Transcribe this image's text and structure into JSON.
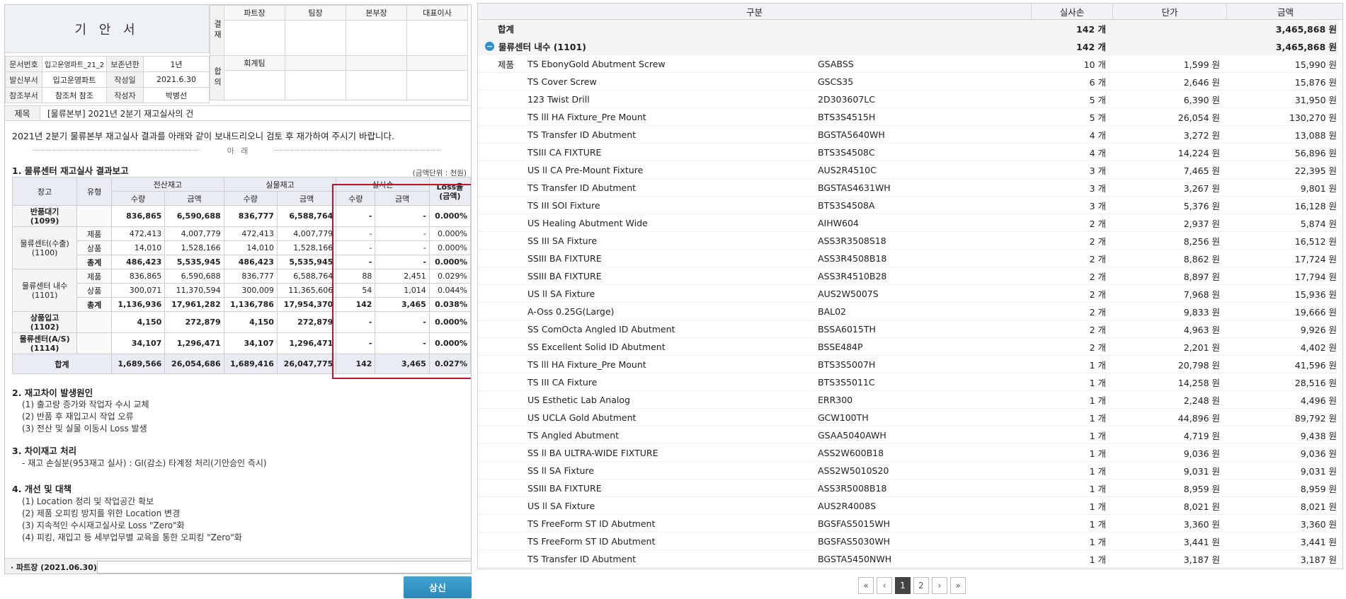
{
  "document": {
    "title": "기 안 서",
    "approval": {
      "side_label_top": "결재",
      "side_label_bottom": "합의",
      "headers": [
        "파트장",
        "팀장",
        "본부장",
        "대표이사"
      ],
      "agree_header": "회계팀"
    },
    "meta": {
      "doc_no_label": "문서번호",
      "doc_no": "입고운영파트_21_2",
      "retention_label": "보존년한",
      "retention": "1년",
      "dept_label": "발신부서",
      "dept": "입고운영파트",
      "date_label": "작성일",
      "date": "2021.6.30",
      "ref_label": "참조부서",
      "ref": "참조처 참조",
      "author_label": "작성자",
      "author": "박병선"
    },
    "subject_label": "제목",
    "subject": "[물류본부] 2021년 2분기 재고실사의 건",
    "intro": "2021년 2분기 물류본부 재고실사 결과를 아래와 같이 보내드리오니 검토 후 재가하여 주시기 바랍니다.",
    "ara": "아 래",
    "sec1": "1. 물류센터 재고실사 결과보고",
    "unit": "(금액단위 : 천원)",
    "table": {
      "h_wh": "창고",
      "h_type": "유형",
      "h_sys": "전산재고",
      "h_phy": "실물재고",
      "h_loss": "실사손",
      "h_rate": "Loss율(금액)",
      "h_qty": "수량",
      "h_amt": "금액",
      "groups": [
        {
          "name": "반품대기\n(1099)",
          "rows": [
            {
              "type": "",
              "v": [
                "836,865",
                "6,590,688",
                "836,777",
                "6,588,764",
                "-",
                "-",
                "0.000%"
              ],
              "bold": true
            }
          ]
        },
        {
          "name": "물류센터(수출)\n(1100)",
          "rows": [
            {
              "type": "제품",
              "v": [
                "472,413",
                "4,007,779",
                "472,413",
                "4,007,779",
                "-",
                "-",
                "0.000%"
              ],
              "bold": false
            },
            {
              "type": "상품",
              "v": [
                "14,010",
                "1,528,166",
                "14,010",
                "1,528,166",
                "-",
                "-",
                "0.000%"
              ],
              "bold": false
            },
            {
              "type": "총계",
              "v": [
                "486,423",
                "5,535,945",
                "486,423",
                "5,535,945",
                "-",
                "-",
                "0.000%"
              ],
              "bold": true
            }
          ]
        },
        {
          "name": "물류센터 내수\n(1101)",
          "rows": [
            {
              "type": "제품",
              "v": [
                "836,865",
                "6,590,688",
                "836,777",
                "6,588,764",
                "88",
                "2,451",
                "0.029%"
              ],
              "bold": false
            },
            {
              "type": "상품",
              "v": [
                "300,071",
                "11,370,594",
                "300,009",
                "11,365,606",
                "54",
                "1,014",
                "0.044%"
              ],
              "bold": false
            },
            {
              "type": "총계",
              "v": [
                "1,136,936",
                "17,961,282",
                "1,136,786",
                "17,954,370",
                "142",
                "3,465",
                "0.038%"
              ],
              "bold": true
            }
          ]
        },
        {
          "name": "상품입고\n(1102)",
          "rows": [
            {
              "type": "",
              "v": [
                "4,150",
                "272,879",
                "4,150",
                "272,879",
                "-",
                "-",
                "0.000%"
              ],
              "bold": true
            }
          ]
        },
        {
          "name": "물류센터(A/S)\n(1114)",
          "rows": [
            {
              "type": "",
              "v": [
                "34,107",
                "1,296,471",
                "34,107",
                "1,296,471",
                "-",
                "-",
                "0.000%"
              ],
              "bold": true
            }
          ]
        }
      ],
      "total_label": "합계",
      "total": [
        "1,689,566",
        "26,054,686",
        "1,689,416",
        "26,047,775",
        "142",
        "3,465",
        "0.027%"
      ]
    },
    "sec2": "2. 재고차이 발생원인",
    "causes": [
      "(1) 출고량 증가와 작업자 수시 교체",
      "(2) 반품 후 재입고시 작업 오류",
      "(3) 전산 및 실물 이동시 Loss 발생"
    ],
    "sec3": "3. 차이재고 처리",
    "handling": "-  재고 손실분(953재고 실사) : GI(감소) 타계정 처리(기안승인 즉시)",
    "sec4": "4. 개선 및 대책",
    "measures": [
      "(1) Location 정리 및 작업공간 확보",
      "(2) 제품 오피킹 방지를 위한 Location 변경",
      "(3) 지속적인 수시재고실사로 Loss \"Zero\"화",
      "(4) 피킹, 재입고 등 세부업무별 교육을 통한 오피킹 \"Zero\"화"
    ],
    "footer_label": "· 파트장  (2021.06.30)",
    "footer_input": "",
    "submit_label": "상신"
  },
  "grid": {
    "headers": [
      "구분",
      "실사손",
      "단가",
      "금액"
    ],
    "total": {
      "label": "합계",
      "qty": "142 개",
      "amount": "3,465,868 원"
    },
    "group": {
      "label": "물류센터 내수 (1101)",
      "qty": "142 개",
      "amount": "3,465,868 원"
    },
    "category": "제품",
    "rows": [
      {
        "name": "TS EbonyGold Abutment Screw",
        "code": "GSABSS",
        "qty": "10 개",
        "price": "1,599 원",
        "amount": "15,990 원"
      },
      {
        "name": "TS Cover Screw",
        "code": "GSCS35",
        "qty": "6 개",
        "price": "2,646 원",
        "amount": "15,876 원"
      },
      {
        "name": "123 Twist Drill",
        "code": "2D303607LC",
        "qty": "5 개",
        "price": "6,390 원",
        "amount": "31,950 원"
      },
      {
        "name": "TS lll HA Fixture_Pre Mount",
        "code": "BTS3S4515H",
        "qty": "5 개",
        "price": "26,054 원",
        "amount": "130,270 원"
      },
      {
        "name": "TS Transfer ID Abutment",
        "code": "BGSTA5640WH",
        "qty": "4 개",
        "price": "3,272 원",
        "amount": "13,088 원"
      },
      {
        "name": "TSIII CA FIXTURE",
        "code": "BTS3S4508C",
        "qty": "4 개",
        "price": "14,224 원",
        "amount": "56,896 원"
      },
      {
        "name": "US ll CA Pre-Mount Fixture",
        "code": "AUS2R4510C",
        "qty": "3 개",
        "price": "7,465 원",
        "amount": "22,395 원"
      },
      {
        "name": "TS Transfer ID Abutment",
        "code": "BGSTAS4631WH",
        "qty": "3 개",
        "price": "3,267 원",
        "amount": "9,801 원"
      },
      {
        "name": "TS III SOI Fixture",
        "code": "BTS3S4508A",
        "qty": "3 개",
        "price": "5,376 원",
        "amount": "16,128 원"
      },
      {
        "name": "US Healing Abutment Wide",
        "code": "AIHW604",
        "qty": "2 개",
        "price": "2,937 원",
        "amount": "5,874 원"
      },
      {
        "name": "SS III SA Fixture",
        "code": "ASS3R3508S18",
        "qty": "2 개",
        "price": "8,256 원",
        "amount": "16,512 원"
      },
      {
        "name": "SSIII BA FIXTURE",
        "code": "ASS3R4508B18",
        "qty": "2 개",
        "price": "8,862 원",
        "amount": "17,724 원"
      },
      {
        "name": "SSIII BA FIXTURE",
        "code": "ASS3R4510B28",
        "qty": "2 개",
        "price": "8,897 원",
        "amount": "17,794 원"
      },
      {
        "name": "US ll SA Fixture",
        "code": "AUS2W5007S",
        "qty": "2 개",
        "price": "7,968 원",
        "amount": "15,936 원"
      },
      {
        "name": "A-Oss 0.25G(Large)",
        "code": "BAL02",
        "qty": "2 개",
        "price": "9,833 원",
        "amount": "19,666 원"
      },
      {
        "name": "SS ComOcta Angled ID Abutment",
        "code": "BSSA6015TH",
        "qty": "2 개",
        "price": "4,963 원",
        "amount": "9,926 원"
      },
      {
        "name": "SS Excellent Solid ID Abutment",
        "code": "BSSE484P",
        "qty": "2 개",
        "price": "2,201 원",
        "amount": "4,402 원"
      },
      {
        "name": "TS lll HA Fixture_Pre Mount",
        "code": "BTS3S5007H",
        "qty": "1 개",
        "price": "20,798 원",
        "amount": "41,596 원"
      },
      {
        "name": "TS III CA Fixture",
        "code": "BTS3S5011C",
        "qty": "1 개",
        "price": "14,258 원",
        "amount": "28,516 원"
      },
      {
        "name": "US Esthetic Lab Analog",
        "code": "ERR300",
        "qty": "1 개",
        "price": "2,248 원",
        "amount": "4,496 원"
      },
      {
        "name": "US UCLA Gold Abutment",
        "code": "GCW100TH",
        "qty": "1 개",
        "price": "44,896 원",
        "amount": "89,792 원"
      },
      {
        "name": "TS Angled Abutment",
        "code": "GSAA5040AWH",
        "qty": "1 개",
        "price": "4,719 원",
        "amount": "9,438 원"
      },
      {
        "name": "SS ll BA ULTRA-WIDE FIXTURE",
        "code": "ASS2W600B18",
        "qty": "1 개",
        "price": "9,036 원",
        "amount": "9,036 원"
      },
      {
        "name": "SS ll SA Fixture",
        "code": "ASS2W5010S20",
        "qty": "1 개",
        "price": "9,031 원",
        "amount": "9,031 원"
      },
      {
        "name": "SSIII BA FIXTURE",
        "code": "ASS3R5008B18",
        "qty": "1 개",
        "price": "8,959 원",
        "amount": "8,959 원"
      },
      {
        "name": "US ll SA Fixture",
        "code": "AUS2R4008S",
        "qty": "1 개",
        "price": "8,021 원",
        "amount": "8,021 원"
      },
      {
        "name": "TS FreeForm ST ID Abutment",
        "code": "BGSFAS5015WH",
        "qty": "1 개",
        "price": "3,360 원",
        "amount": "3,360 원"
      },
      {
        "name": "TS FreeForm ST ID Abutment",
        "code": "BGSFAS5030WH",
        "qty": "1 개",
        "price": "3,441 원",
        "amount": "3,441 원"
      },
      {
        "name": "TS Transfer ID Abutment",
        "code": "BGSTA5450NWH",
        "qty": "1 개",
        "price": "3,187 원",
        "amount": "3,187 원"
      }
    ]
  },
  "pager": {
    "first": "«",
    "prev": "‹",
    "pages": [
      "1",
      "2"
    ],
    "current": "1",
    "next": "›",
    "last": "»"
  }
}
